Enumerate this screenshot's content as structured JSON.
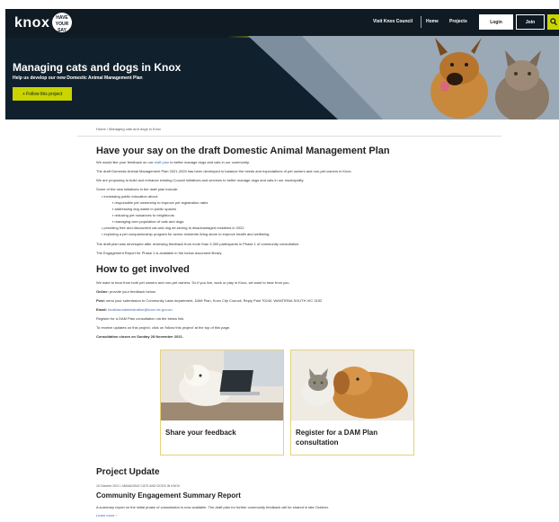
{
  "header": {
    "logo_text": "knox",
    "logo_badge": "HAVE YOUR SAY",
    "nav": {
      "council": "Visit Knox Council",
      "home": "Home",
      "projects": "Projects"
    },
    "login": "Login",
    "join": "Join"
  },
  "hero": {
    "title": "Managing cats and dogs in Knox",
    "subtitle": "Help us develop our new Domestic Animal Management Plan",
    "follow_button": "+ Follow this project"
  },
  "breadcrumb": "Home / Managing cats and dogs in Knox",
  "main": {
    "title": "Have your say on the draft Domestic Animal Management Plan",
    "p1_before": "We would like your feedback on our ",
    "p1_link": "draft plan",
    "p1_after": " to better manage dogs and cats in our community.",
    "p2": "The draft Domestic Animal Management Plan 2021-2025 has been developed to balance the needs and expectations of pet owners and non-pet owners in Knox.",
    "p3": "We are proposing to build and enhance existing Council initiatives and services to better manage dogs and cats in our municipality.",
    "p4": "Some of the new initiatives in the draft plan include:",
    "bullets": [
      "increasing public education about:",
      "responsible pet ownership to improve pet registration rates",
      "addressing dog waste in public spaces",
      "reducing pet nuisances to neighbours",
      "managing over-population of cats and dogs.",
      "providing free and discounted cat and dog de-sexing to disadvantaged residents in 2022",
      "exploring a pet companionship program for senior residents living alone to improve health and wellbeing."
    ],
    "p5": "The draft plan was developed after reviewing feedback from more than 3,300 participants in Phase 1 of community consultation.",
    "p6": "The Engagement Report for Phase 1 is available in the below document library."
  },
  "involved": {
    "title": "How to get involved",
    "p1": "We want to hear from both pet owners and non-pet owners. So if you live, work or play in Knox, we want to hear from you.",
    "online_label": "Online:",
    "online_text": " provide your feedback below.",
    "post_label": "Post:",
    "post_text": " send your submission to Community Laws department, DAM Plan, Knox City Council, Reply Paid 70240, WANTIRNA SOUTH VIC 3152",
    "email_label": "Email:",
    "email_link": "localIaw.administration@knox.vic.gov.au",
    "p_register": "Register for a DAM Plan consultation via the below link.",
    "p_updates": "To receive updates on this project, click on 'follow this project' at the top of this page.",
    "closes": "Consultation closes on  Sunday 28 November 2021."
  },
  "cards": [
    {
      "label_line1": "Share your feedback",
      "label_line2": ""
    },
    {
      "label_line1": "Register for a DAM Plan",
      "label_line2": "consultation"
    }
  ],
  "update": {
    "title": "Project Update",
    "meta": "15 October 2021 • MANAGING CATS AND DOGS IN KNOX",
    "heading": "Community Engagement Summary Report",
    "text": "A summary report on the initial phase of consultation is now available. The draft plan for further community feedback will be shared in late October.",
    "learn_more": "Learn more ›"
  },
  "colors": {
    "accent": "#c9d400",
    "navy": "#0f1a23",
    "link": "#3a6fb0"
  }
}
